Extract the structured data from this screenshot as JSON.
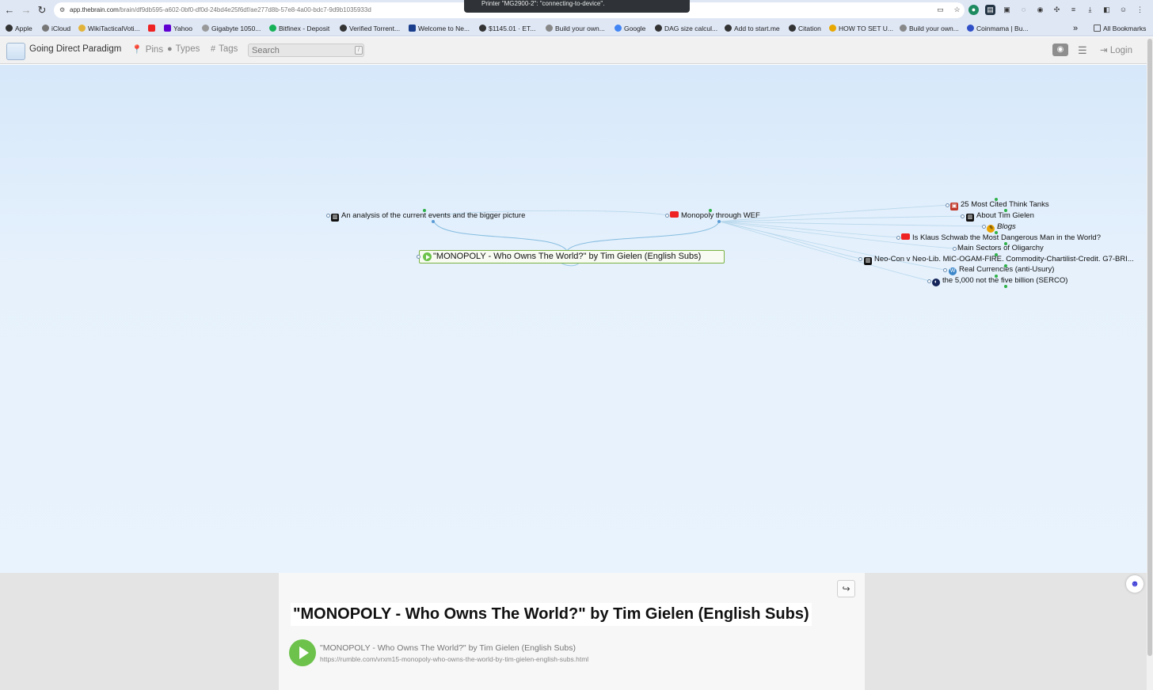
{
  "browser": {
    "url_host": "app.thebrain.com",
    "url_path": "/brain/df9db595-a602-0bf0-df0d-24bd4e25f6df/ae277d8b-57e8-4a00-bdc7-9d9b1035933d",
    "toast": "Printer \"MG2900-2\": \"connecting-to-device\".",
    "bookmarks": [
      "Apple",
      "iCloud",
      "WikiTacticalVoti...",
      "",
      "Yahoo",
      "Gigabyte 1050...",
      "Bitfinex - Deposit",
      "Verified Torrent...",
      "Welcome to Ne...",
      "$1145.01 · ET...",
      "Build your own...",
      "Google",
      "DAG size calcul...",
      "Add to start.me",
      "Citation",
      "HOW TO SET U...",
      "Build your own...",
      "Coinmama | Bu..."
    ],
    "bookmarks_more": "»",
    "all_bookmarks": "All Bookmarks"
  },
  "header": {
    "brain_name": "Going Direct Paradigm",
    "pins": "Pins",
    "types": "Types",
    "tags": "Tags",
    "search_placeholder": "Search",
    "search_key": "/",
    "login": "Login"
  },
  "plex": {
    "parents": [
      {
        "label": "An analysis of the current events and the bigger picture",
        "icon": "document-icon"
      },
      {
        "label": "Monopoly through WEF",
        "icon": "youtube-icon"
      }
    ],
    "active": "\"MONOPOLY - Who Owns The World?\" by Tim Gielen (English Subs)",
    "jumps": [
      {
        "label": "25 Most Cited Think Tanks",
        "icon": "think-tank-icon"
      },
      {
        "label": "About Tim Gielen",
        "icon": "document-icon"
      },
      {
        "label": "Blogs",
        "icon": "blog-icon"
      },
      {
        "label": "Is Klaus Schwab the Most Dangerous Man in the World?",
        "icon": "youtube-icon"
      },
      {
        "label": "Main Sectors of Oligarchy",
        "icon": ""
      },
      {
        "label": "Neo-Con v Neo-Lib. MIC-OGAM-FIRE. Commodity-Chartilist-Credit. G7-BRI...",
        "icon": "document-icon"
      },
      {
        "label": "Real Currencies (anti-Usury)",
        "icon": "wordpress-icon"
      },
      {
        "label": "the 5,000 not the five billion (SERCO)",
        "icon": "serco-icon"
      }
    ]
  },
  "notes": {
    "title": "\"MONOPOLY - Who Owns The World?\" by Tim Gielen (English Subs)",
    "attachment_title": "\"MONOPOLY - Who Owns The World?\" by Tim Gielen (English Subs)",
    "attachment_url": "https://rumble.com/vrxm15-monopoly-who-owns-the-world-by-tim-gielen-english-subs.html"
  },
  "colors": {
    "accent_green": "#6cc24a",
    "link_blue": "#7fb7d9",
    "plex_bg": "#e6f1fc"
  }
}
